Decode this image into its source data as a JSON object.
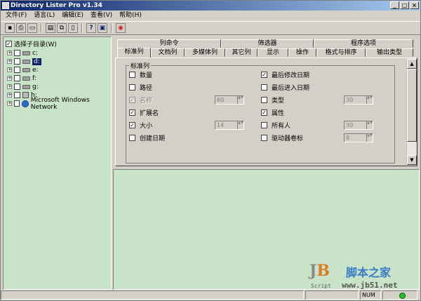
{
  "window": {
    "title": "Directory Lister Pro v1.34",
    "min": "_",
    "max": "□",
    "close": "×"
  },
  "menu": [
    "文件(F)",
    "语言(L)",
    "编辑(E)",
    "查看(V)",
    "帮助(H)"
  ],
  "toolbar": {
    "glyphs": [
      "▪",
      "⎙",
      "▭",
      "▤",
      "⧉",
      "▯",
      "?",
      "▣",
      "◉"
    ]
  },
  "tree": {
    "root_label": "选择子目录(W)",
    "root_checked": "✓",
    "expander": "+",
    "items": [
      "c:",
      "d:",
      "e:",
      "f:",
      "g:",
      "h:",
      "Microsoft Windows Network"
    ]
  },
  "tabs": {
    "row1": [
      "列命令",
      "筛选器",
      "程序选项"
    ],
    "row2": [
      "标准列",
      "文档列",
      "多媒体列",
      "其它列",
      "显示",
      "操作",
      "格式与排序",
      "输出类型"
    ]
  },
  "group": {
    "label": "标准列",
    "check": "✓",
    "left": [
      {
        "label": "数量",
        "checked": false,
        "disabled": false
      },
      {
        "label": "路径",
        "checked": false,
        "disabled": false
      },
      {
        "label": "名称",
        "checked": true,
        "disabled": true,
        "spin": "60"
      },
      {
        "label": "扩展名",
        "checked": true,
        "disabled": false
      },
      {
        "label": "大小",
        "checked": true,
        "disabled": false,
        "spin": "14"
      },
      {
        "label": "创建日期",
        "checked": false,
        "disabled": false
      }
    ],
    "right": [
      {
        "label": "最后修改日期",
        "checked": true,
        "disabled": false
      },
      {
        "label": "最后进入日期",
        "checked": false,
        "disabled": false
      },
      {
        "label": "类型",
        "checked": false,
        "disabled": false,
        "spin": "30"
      },
      {
        "label": "属性",
        "checked": true,
        "disabled": false
      },
      {
        "label": "所有人",
        "checked": false,
        "disabled": false,
        "spin": "30"
      },
      {
        "label": "驱动器卷标",
        "checked": false,
        "disabled": false,
        "spin": "8"
      }
    ]
  },
  "scroll": {
    "up": "▲",
    "down": "▼",
    "spin_arrows": "▲▼"
  },
  "statusbar": {
    "num": "NUM"
  },
  "watermark": {
    "logo_j": "J",
    "logo_b": "B",
    "cn": "脚本之家",
    "script": "Script",
    "url": "www.jb51.net"
  }
}
